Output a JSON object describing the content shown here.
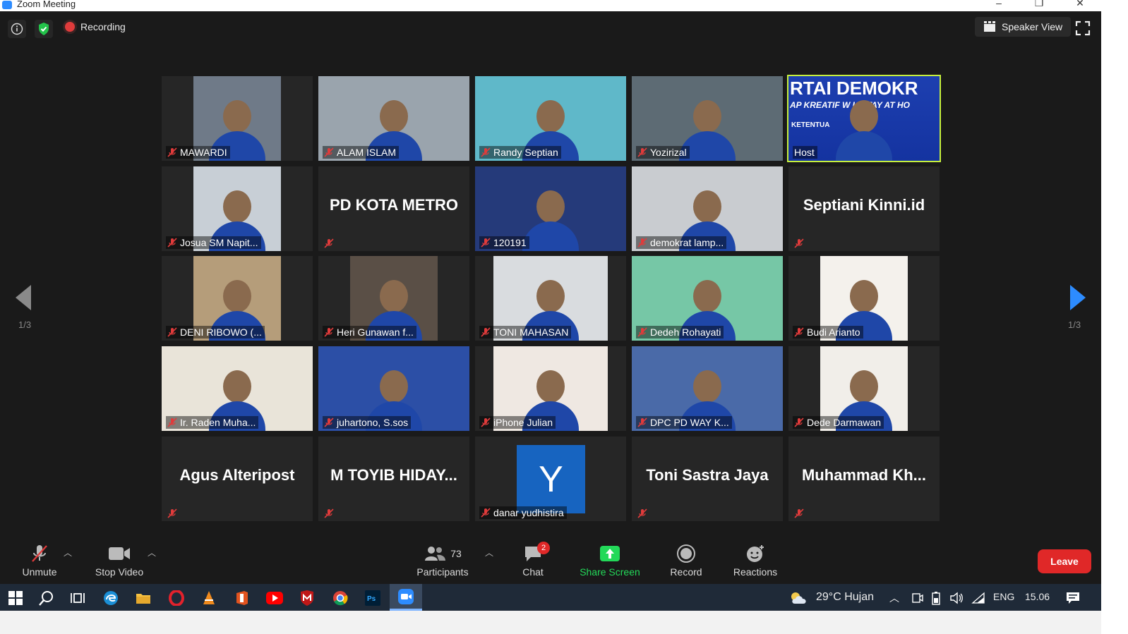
{
  "window": {
    "title": "Zoom Meeting"
  },
  "top_bar": {
    "recording_label": "Recording",
    "speaker_view_label": "Speaker View"
  },
  "pagination": {
    "left_page": "1/3",
    "right_page": "1/3"
  },
  "tiles": [
    {
      "name": "MAWARDI",
      "video": true
    },
    {
      "name": "ALAM ISLAM",
      "video": true
    },
    {
      "name": "Randy Septian",
      "video": true
    },
    {
      "name": "Yozirizal",
      "video": true
    },
    {
      "name": "Host",
      "video": true,
      "host": true,
      "banner_line1": "RTAI DEMOKR",
      "banner_line2": "AP KREATIF W   U STAY AT HO",
      "banner_line3": "KETENTUA"
    },
    {
      "name": "Josua SM Napit...",
      "video": true
    },
    {
      "name": "",
      "video": false,
      "display_name": "PD KOTA METRO"
    },
    {
      "name": "120191",
      "video": true
    },
    {
      "name": "demokrat lamp...",
      "video": true
    },
    {
      "name": "",
      "video": false,
      "display_name": "Septiani Kinni.id"
    },
    {
      "name": "DENI RIBOWO (...",
      "video": true
    },
    {
      "name": "Heri Gunawan f...",
      "video": true
    },
    {
      "name": "TONI MAHASAN",
      "video": true
    },
    {
      "name": "Dedeh Rohayati",
      "video": true
    },
    {
      "name": "Budi Arianto",
      "video": true
    },
    {
      "name": "Ir. Raden Muha...",
      "video": true
    },
    {
      "name": "juhartono, S.sos",
      "video": true
    },
    {
      "name": "iPhone Julian",
      "video": true
    },
    {
      "name": "DPC PD WAY K...",
      "video": true
    },
    {
      "name": "Dede Darmawan",
      "video": true
    },
    {
      "name": "",
      "video": false,
      "display_name": "Agus Alteripost"
    },
    {
      "name": "",
      "video": false,
      "display_name": "M TOYIB HIDAY..."
    },
    {
      "name": "danar yudhistira",
      "video": false,
      "avatar_letter": "Y"
    },
    {
      "name": "",
      "video": false,
      "display_name": "Toni Sastra Jaya"
    },
    {
      "name": "",
      "video": false,
      "display_name": "Muhammad  Kh..."
    }
  ],
  "toolbar": {
    "unmute_label": "Unmute",
    "stop_video_label": "Stop Video",
    "participants_label": "Participants",
    "participants_count": "73",
    "chat_label": "Chat",
    "chat_badge": "2",
    "share_screen_label": "Share Screen",
    "record_label": "Record",
    "reactions_label": "Reactions",
    "leave_label": "Leave"
  },
  "taskbar": {
    "weather": "29°C  Hujan",
    "language": "ENG",
    "time": "15.06"
  },
  "colors": {
    "accent_blue": "#2d8cff",
    "share_green": "#23d959",
    "leave_red": "#e02828",
    "host_highlight": "#c7f03d"
  }
}
